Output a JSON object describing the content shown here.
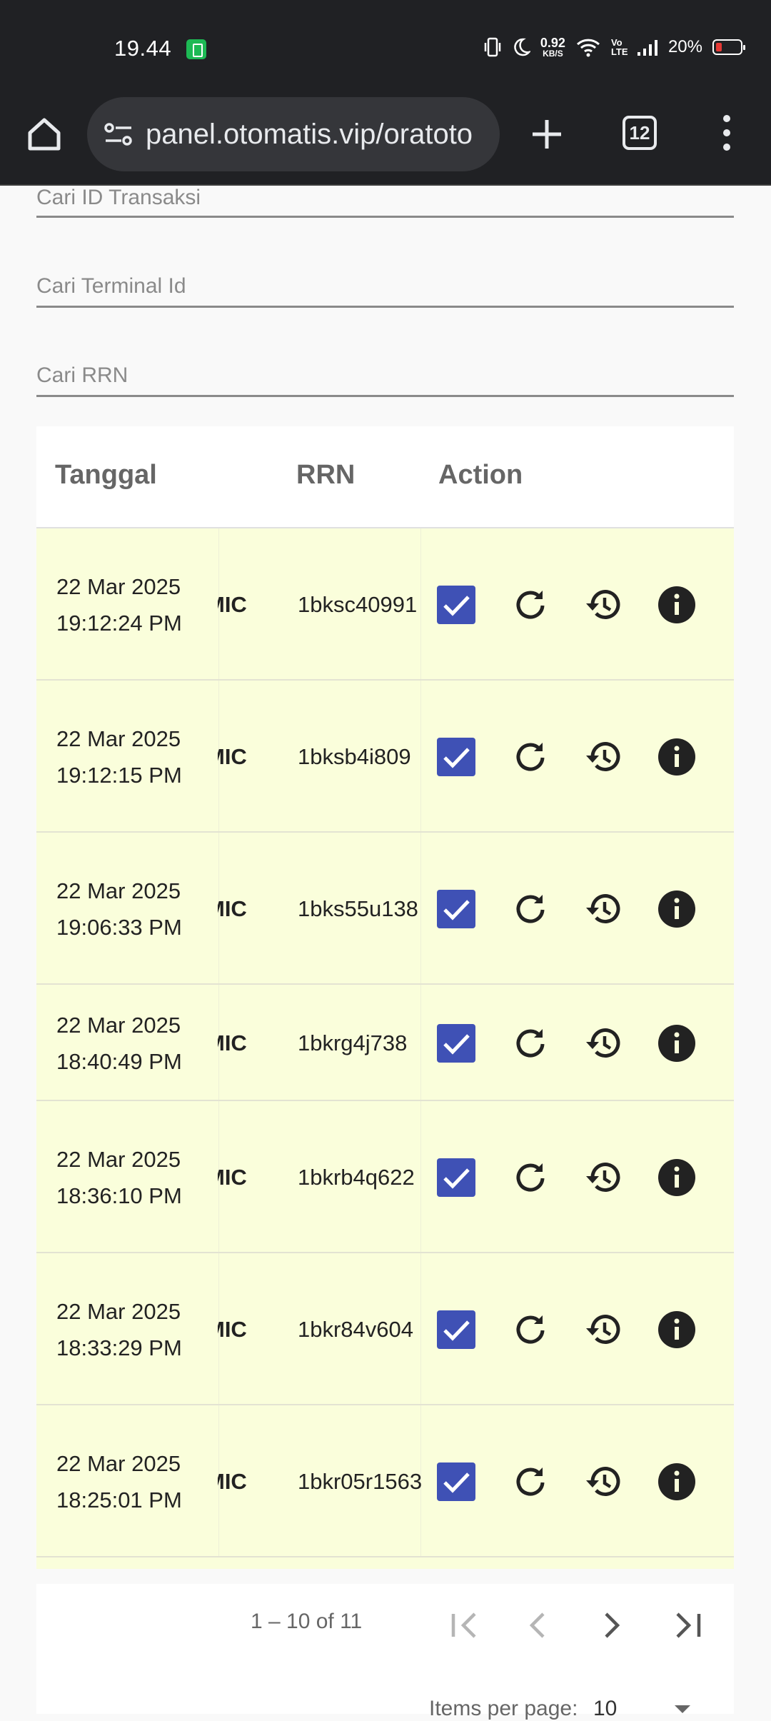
{
  "status_bar": {
    "time": "19.44",
    "speed_value": "0.92",
    "speed_unit": "KB/S",
    "volte": "Vo LTE",
    "battery_percent": "20%"
  },
  "browser": {
    "url": "panel.otomatis.vip/oratoto",
    "tab_count": "12"
  },
  "filters": {
    "transaction_placeholder": "Cari ID Transaksi",
    "terminal_placeholder": "Cari Terminal Id",
    "rrn_placeholder": "Cari RRN"
  },
  "table": {
    "headers": {
      "date": "Tanggal",
      "rrn": "RRN",
      "action": "Action"
    },
    "rows": [
      {
        "date": "22 Mar 2025",
        "time": "19:12:24 PM",
        "type": "MIC",
        "rrn": "1bksc40991"
      },
      {
        "date": "22 Mar 2025",
        "time": "19:12:15 PM",
        "type": "MIC",
        "rrn": "1bksb4i809"
      },
      {
        "date": "22 Mar 2025",
        "time": "19:06:33 PM",
        "type": "MIC",
        "rrn": "1bks55u138"
      },
      {
        "date": "22 Mar 2025",
        "time": "18:40:49 PM",
        "type": "MIC",
        "rrn": "1bkrg4j738"
      },
      {
        "date": "22 Mar 2025",
        "time": "18:36:10 PM",
        "type": "MIC",
        "rrn": "1bkrb4q622"
      },
      {
        "date": "22 Mar 2025",
        "time": "18:33:29 PM",
        "type": "MIC",
        "rrn": "1bkr84v604"
      },
      {
        "date": "22 Mar 2025",
        "time": "18:25:01 PM",
        "type": "MIC",
        "rrn": "1bkr05r1563"
      }
    ]
  },
  "paginator": {
    "range": "1 – 10 of 11",
    "items_per_page_label": "Items per page:",
    "items_per_page_value": "10"
  },
  "colors": {
    "row_background": "#fafedb",
    "checkbox": "#3f51b5",
    "browser_chrome": "#202124"
  },
  "icons": {
    "status": [
      "battery-saver-icon",
      "vibrate-icon",
      "moon-icon",
      "wifi-icon",
      "signal-icon",
      "battery-icon"
    ],
    "browser": [
      "home-icon",
      "tune-icon",
      "plus-icon",
      "tabs-icon",
      "more-vert-icon"
    ],
    "row_actions": [
      "checkbox-icon",
      "refresh-icon",
      "history-icon",
      "info-icon"
    ],
    "paginator": [
      "first-page-icon",
      "prev-page-icon",
      "next-page-icon",
      "last-page-icon"
    ]
  }
}
